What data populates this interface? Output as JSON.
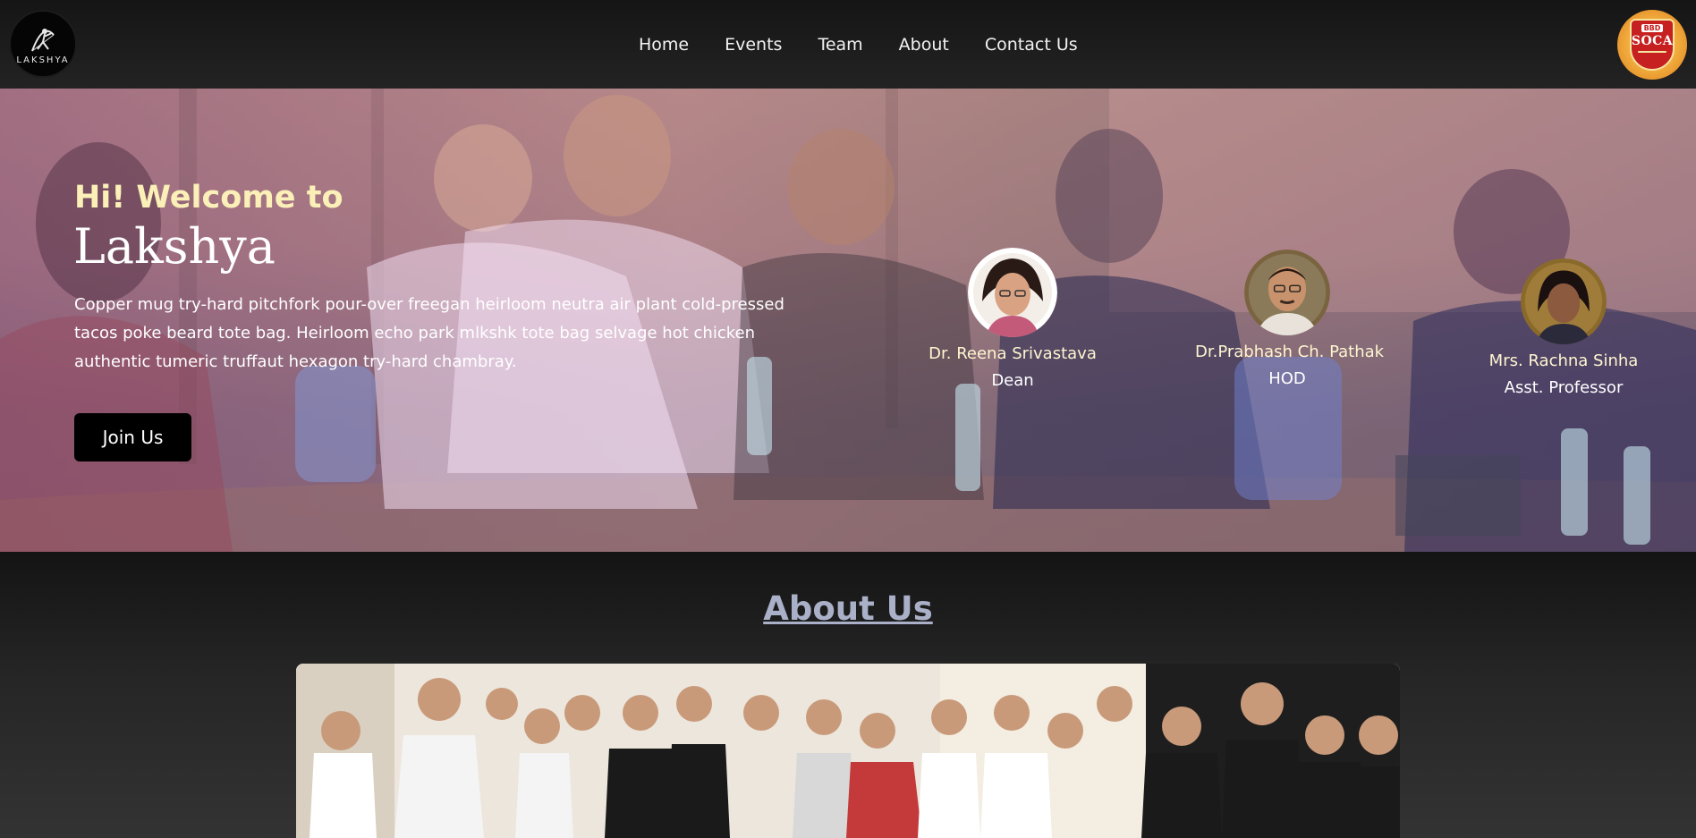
{
  "header": {
    "logo_left_text": "LAKSHYA",
    "nav": [
      "Home",
      "Events",
      "Team",
      "About",
      "Contact Us"
    ],
    "logo_right": {
      "top_text": "BBD",
      "main_text": "SOCA"
    }
  },
  "hero": {
    "greeting": "Hi! Welcome to",
    "title": "Lakshya",
    "description": "Copper mug try-hard pitchfork pour-over freegan heirloom neutra air plant cold-pressed tacos poke beard tote bag. Heirloom echo park mlkshk tote bag selvage hot chicken authentic tumeric truffaut hexagon try-hard chambray.",
    "join_label": "Join Us",
    "people": [
      {
        "name": "Dr. Reena Srivastava",
        "role": "Dean"
      },
      {
        "name": "Dr.Prabhash Ch. Pathak",
        "role": "HOD"
      },
      {
        "name": "Mrs. Rachna Sinha",
        "role": "Asst. Professor"
      }
    ]
  },
  "about": {
    "title": "About Us"
  },
  "colors": {
    "greeting": "#fbf0b8",
    "about_title": "#aab0c8",
    "button_bg": "#000000"
  }
}
